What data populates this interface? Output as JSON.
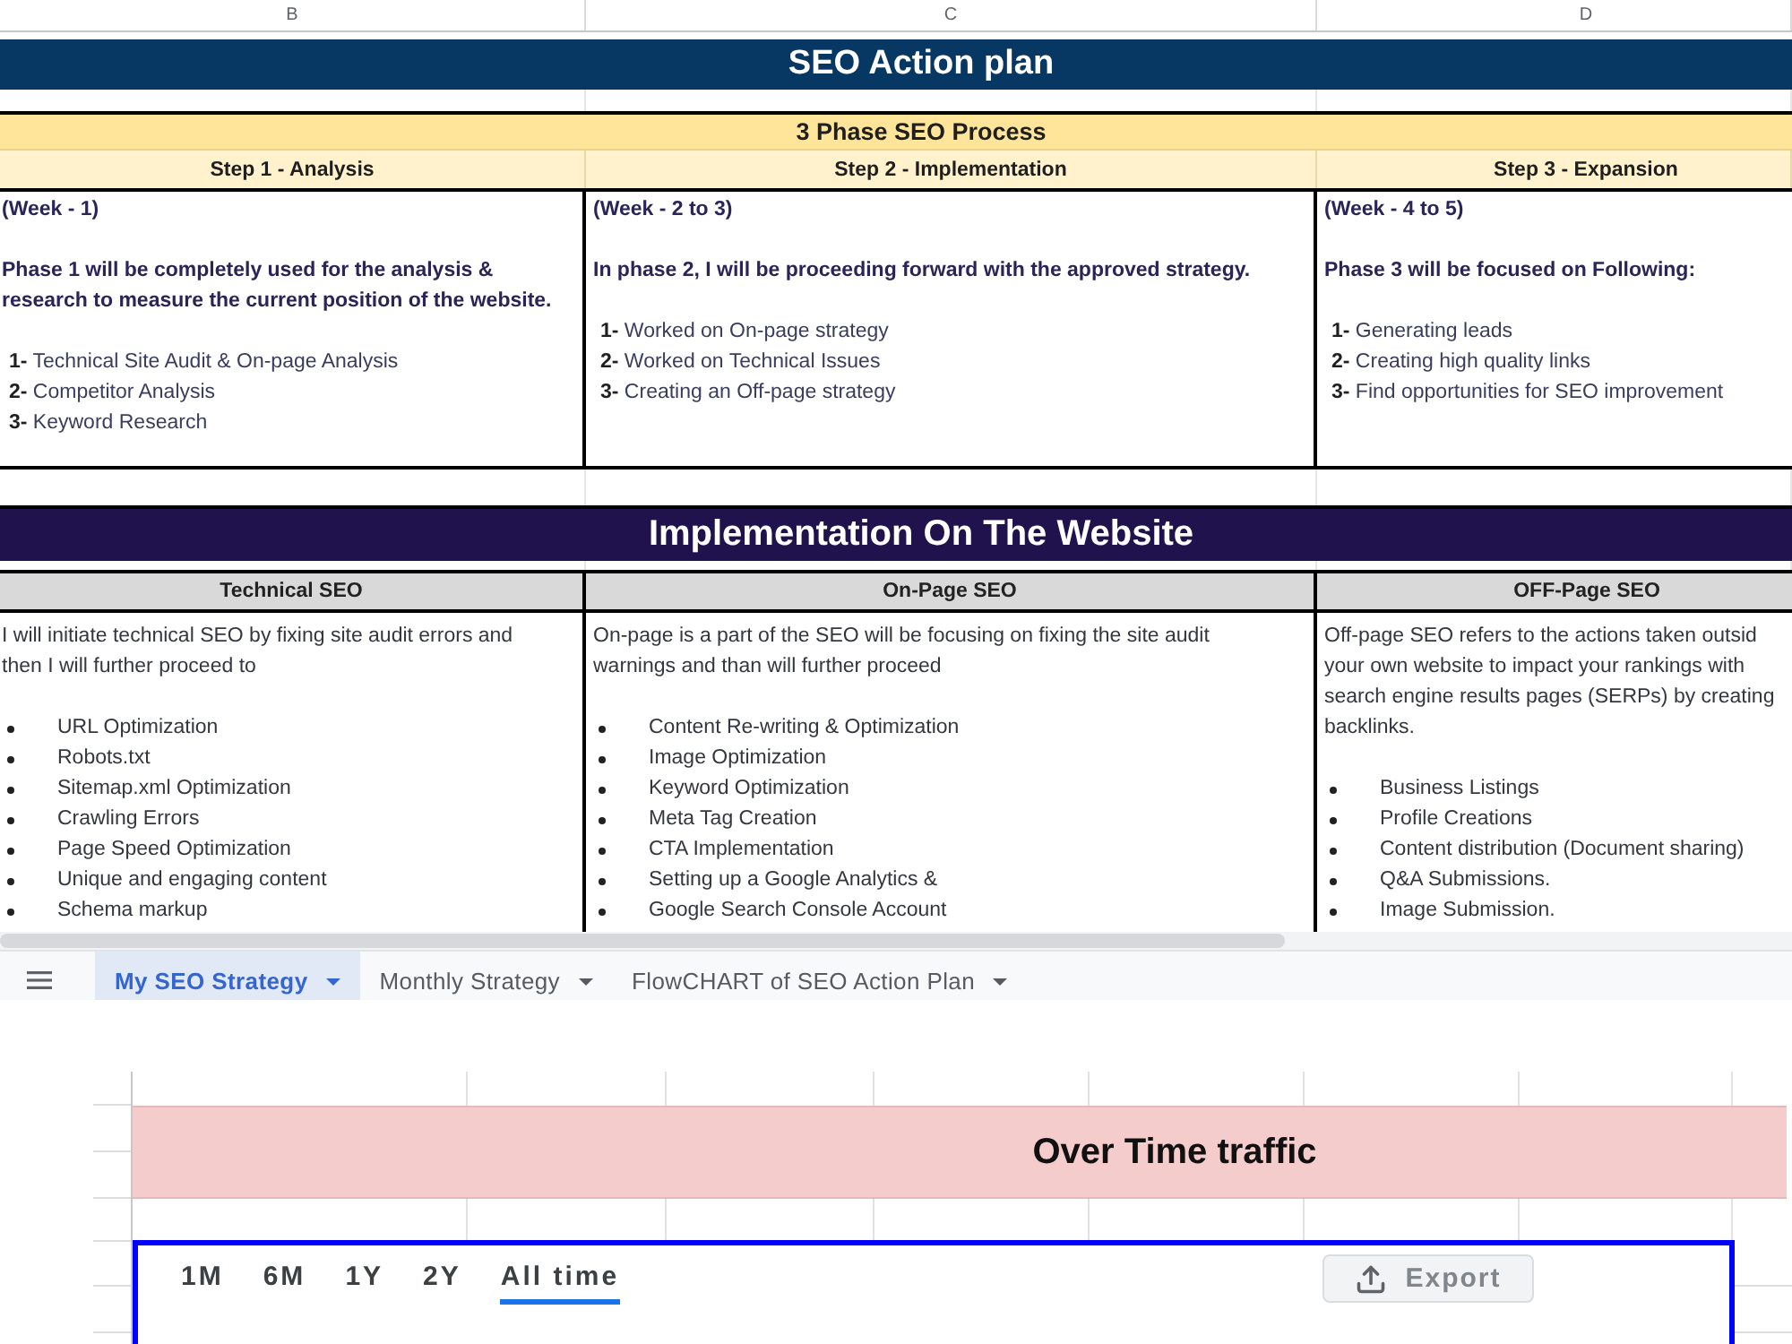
{
  "column_headers": [
    "B",
    "C",
    "D"
  ],
  "title": "SEO Action plan",
  "process": {
    "title": "3 Phase SEO Process",
    "steps": [
      {
        "heading": "Step 1 - Analysis",
        "week": "(Week - 1)",
        "intro": "Phase 1 will be completely used for the analysis &\nresearch to measure the current position of the website.",
        "items": [
          "**1-** Technical Site Audit & On-page Analysis",
          "**2-** Competitor Analysis",
          "**3-** Keyword Research"
        ]
      },
      {
        "heading": "Step 2 - Implementation",
        "week": "(Week - 2 to 3)",
        "intro": "In phase 2, I will be proceeding forward with the approved strategy.",
        "items": [
          "**1-** Worked on On-page strategy",
          "**2-** Worked on Technical Issues",
          "**3-** Creating an Off-page strategy"
        ]
      },
      {
        "heading": "Step 3 - Expansion",
        "week": "(Week - 4 to 5)",
        "intro": "Phase 3 will be focused on Following:",
        "items": [
          "**1-** Generating leads",
          "**2-** Creating high quality links",
          "**3-** Find opportunities for SEO improvement"
        ]
      }
    ]
  },
  "implementation": {
    "title": "Implementation On The Website",
    "columns": [
      {
        "heading": "Technical SEO",
        "intro": "I will initiate technical SEO by fixing site audit errors and\nthen I will further proceed to",
        "bullets": [
          "URL Optimization",
          "Robots.txt",
          "Sitemap.xml Optimization",
          "Crawling Errors",
          "Page Speed Optimization",
          "Unique and engaging content",
          "Schema markup"
        ]
      },
      {
        "heading": "On-Page SEO",
        "intro": "On-page is a part of the SEO will be focusing on fixing the site audit\nwarnings and than will further proceed",
        "bullets": [
          "Content Re-writing & Optimization",
          "Image Optimization",
          "Keyword Optimization",
          "Meta Tag Creation",
          "CTA Implementation",
          "Setting up a Google Analytics &",
          "Google Search Console Account"
        ]
      },
      {
        "heading": "OFF-Page SEO",
        "intro": "Off-page SEO refers to the actions taken outsid\nyour own website to impact your rankings with\nsearch engine results pages (SERPs) by creating\nbacklinks.",
        "bullets": [
          "Business Listings",
          "Profile Creations",
          "Content distribution (Document sharing)",
          "Q&A Submissions.",
          "Image Submission."
        ]
      }
    ]
  },
  "sheet_tabs": [
    {
      "label": "My SEO Strategy",
      "selected": true
    },
    {
      "label": "Monthly Strategy",
      "selected": false
    },
    {
      "label": "FlowCHART of SEO Action Plan",
      "selected": false
    }
  ],
  "lower_sheet": {
    "banner": "Over Time traffic",
    "ranges": [
      {
        "label": "1M",
        "selected": false
      },
      {
        "label": "6M",
        "selected": false
      },
      {
        "label": "1Y",
        "selected": false
      },
      {
        "label": "2Y",
        "selected": false
      },
      {
        "label": "All time",
        "selected": true
      }
    ],
    "export_label": "Export"
  }
}
